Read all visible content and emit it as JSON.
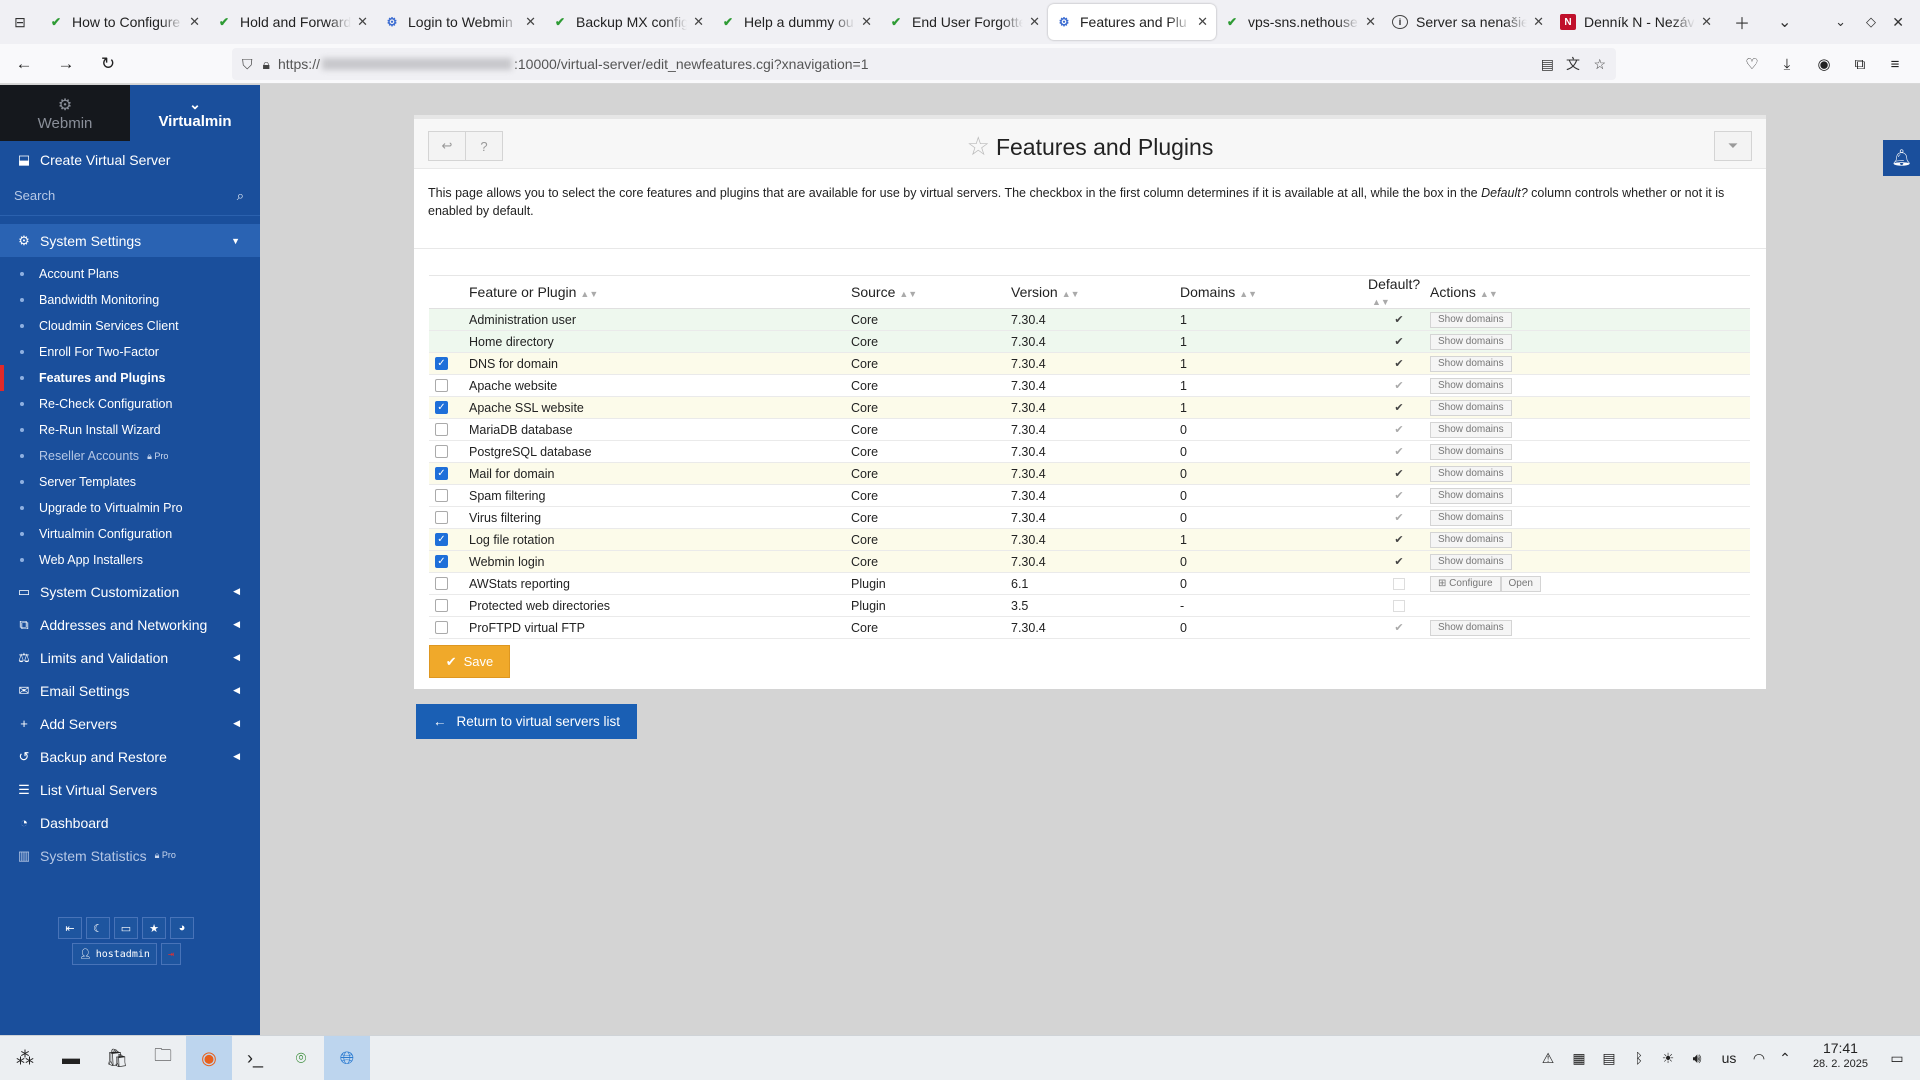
{
  "browser": {
    "tabs": [
      {
        "title": "How to Configure",
        "icon": "virtualmin-icon"
      },
      {
        "title": "Hold and Forward",
        "icon": "virtualmin-icon"
      },
      {
        "title": "Login to Webmin",
        "icon": "webmin-icon"
      },
      {
        "title": "Backup MX config",
        "icon": "virtualmin-icon"
      },
      {
        "title": "Help a dummy ou",
        "icon": "virtualmin-icon"
      },
      {
        "title": "End User Forgotte",
        "icon": "virtualmin-icon"
      },
      {
        "title": "Features and Plu",
        "icon": "webmin-icon",
        "active": true
      },
      {
        "title": "vps-sns.nethouse",
        "icon": "virtualmin-icon"
      },
      {
        "title": "Server sa nenašie",
        "icon": "info-icon"
      },
      {
        "title": "Denník N - Nezáv",
        "icon": "dennik-icon"
      }
    ],
    "url": {
      "prefix": "https://",
      "suffix": ":10000/virtual-server/edit_newfeatures.cgi?xnavigation=1"
    }
  },
  "sidebar": {
    "switch": {
      "webmin": "Webmin",
      "virtualmin": "Virtualmin"
    },
    "create": "Create Virtual Server",
    "search_placeholder": "Search",
    "system_settings": "System Settings",
    "subitems": [
      {
        "label": "Account Plans"
      },
      {
        "label": "Bandwidth Monitoring"
      },
      {
        "label": "Cloudmin Services Client"
      },
      {
        "label": "Enroll For Two-Factor"
      },
      {
        "label": "Features and Plugins",
        "current": true
      },
      {
        "label": "Re-Check Configuration"
      },
      {
        "label": "Re-Run Install Wizard"
      },
      {
        "label": "Reseller Accounts",
        "pro": "Pro",
        "dim": true
      },
      {
        "label": "Server Templates"
      },
      {
        "label": "Upgrade to Virtualmin Pro"
      },
      {
        "label": "Virtualmin Configuration"
      },
      {
        "label": "Web App Installers"
      }
    ],
    "sections": [
      {
        "label": "System Customization",
        "icon": "monitor-icon",
        "arrow": true
      },
      {
        "label": "Addresses and Networking",
        "icon": "network-icon",
        "arrow": true
      },
      {
        "label": "Limits and Validation",
        "icon": "scale-icon",
        "arrow": true
      },
      {
        "label": "Email Settings",
        "icon": "envelope-icon",
        "arrow": true
      },
      {
        "label": "Add Servers",
        "icon": "plus-icon",
        "arrow": true
      },
      {
        "label": "Backup and Restore",
        "icon": "history-icon",
        "arrow": true
      },
      {
        "label": "List Virtual Servers",
        "icon": "list-icon",
        "arrow": false
      },
      {
        "label": "Dashboard",
        "icon": "dashboard-icon",
        "arrow": false
      },
      {
        "label": "System Statistics",
        "icon": "chart-icon",
        "arrow": false,
        "pro": "Pro",
        "dim": true
      }
    ],
    "user": "hostadmin"
  },
  "page": {
    "title": "Features and Plugins",
    "description_1": "This page allows you to select the core features and plugins that are available for use by virtual servers. The checkbox in the first column determines if it is available at all, while the box in the ",
    "description_em": "Default?",
    "description_2": " column controls whether or not it is enabled by default.",
    "columns": [
      "Feature or Plugin",
      "Source",
      "Version",
      "Domains",
      "Default?",
      "Actions"
    ],
    "rows": [
      {
        "name": "Administration user",
        "source": "Core",
        "version": "7.30.4",
        "domains": "1",
        "checkbox": "none",
        "default": "on",
        "action": "Show domains",
        "tone": "g"
      },
      {
        "name": "Home directory",
        "source": "Core",
        "version": "7.30.4",
        "domains": "1",
        "checkbox": "none",
        "default": "on",
        "action": "Show domains",
        "tone": "g"
      },
      {
        "name": "DNS for domain",
        "source": "Core",
        "version": "7.30.4",
        "domains": "1",
        "checkbox": "on",
        "default": "on",
        "action": "Show domains",
        "tone": "y"
      },
      {
        "name": "Apache website",
        "source": "Core",
        "version": "7.30.4",
        "domains": "1",
        "checkbox": "off",
        "default": "off",
        "action": "Show domains",
        "tone": ""
      },
      {
        "name": "Apache SSL website",
        "source": "Core",
        "version": "7.30.4",
        "domains": "1",
        "checkbox": "on",
        "default": "on",
        "action": "Show domains",
        "tone": "y"
      },
      {
        "name": "MariaDB database",
        "source": "Core",
        "version": "7.30.4",
        "domains": "0",
        "checkbox": "off",
        "default": "off",
        "action": "Show domains",
        "tone": ""
      },
      {
        "name": "PostgreSQL database",
        "source": "Core",
        "version": "7.30.4",
        "domains": "0",
        "checkbox": "off",
        "default": "off",
        "action": "Show domains",
        "tone": ""
      },
      {
        "name": "Mail for domain",
        "source": "Core",
        "version": "7.30.4",
        "domains": "0",
        "checkbox": "on",
        "default": "on",
        "action": "Show domains",
        "tone": "y"
      },
      {
        "name": "Spam filtering",
        "source": "Core",
        "version": "7.30.4",
        "domains": "0",
        "checkbox": "off",
        "default": "off",
        "action": "Show domains",
        "tone": ""
      },
      {
        "name": "Virus filtering",
        "source": "Core",
        "version": "7.30.4",
        "domains": "0",
        "checkbox": "off",
        "default": "off",
        "action": "Show domains",
        "tone": ""
      },
      {
        "name": "Log file rotation",
        "source": "Core",
        "version": "7.30.4",
        "domains": "1",
        "checkbox": "on",
        "default": "on",
        "action": "Show domains",
        "tone": "y"
      },
      {
        "name": "Webmin login",
        "source": "Core",
        "version": "7.30.4",
        "domains": "0",
        "checkbox": "on",
        "default": "on",
        "action": "Show domains",
        "tone": "y"
      },
      {
        "name": "AWStats reporting",
        "source": "Plugin",
        "version": "6.1",
        "domains": "0",
        "checkbox": "off",
        "default": "box",
        "action": "Configure",
        "action2": "Open",
        "tone": ""
      },
      {
        "name": "Protected web directories",
        "source": "Plugin",
        "version": "3.5",
        "domains": "-",
        "checkbox": "off",
        "default": "box",
        "action": "",
        "tone": ""
      },
      {
        "name": "ProFTPD virtual FTP",
        "source": "Core",
        "version": "7.30.4",
        "domains": "0",
        "checkbox": "off",
        "default": "off",
        "action": "Show domains",
        "tone": ""
      }
    ],
    "save": "Save",
    "return": "Return to virtual servers list"
  },
  "taskbar": {
    "lang": "us",
    "time": "17:41",
    "date": "28. 2. 2025"
  }
}
